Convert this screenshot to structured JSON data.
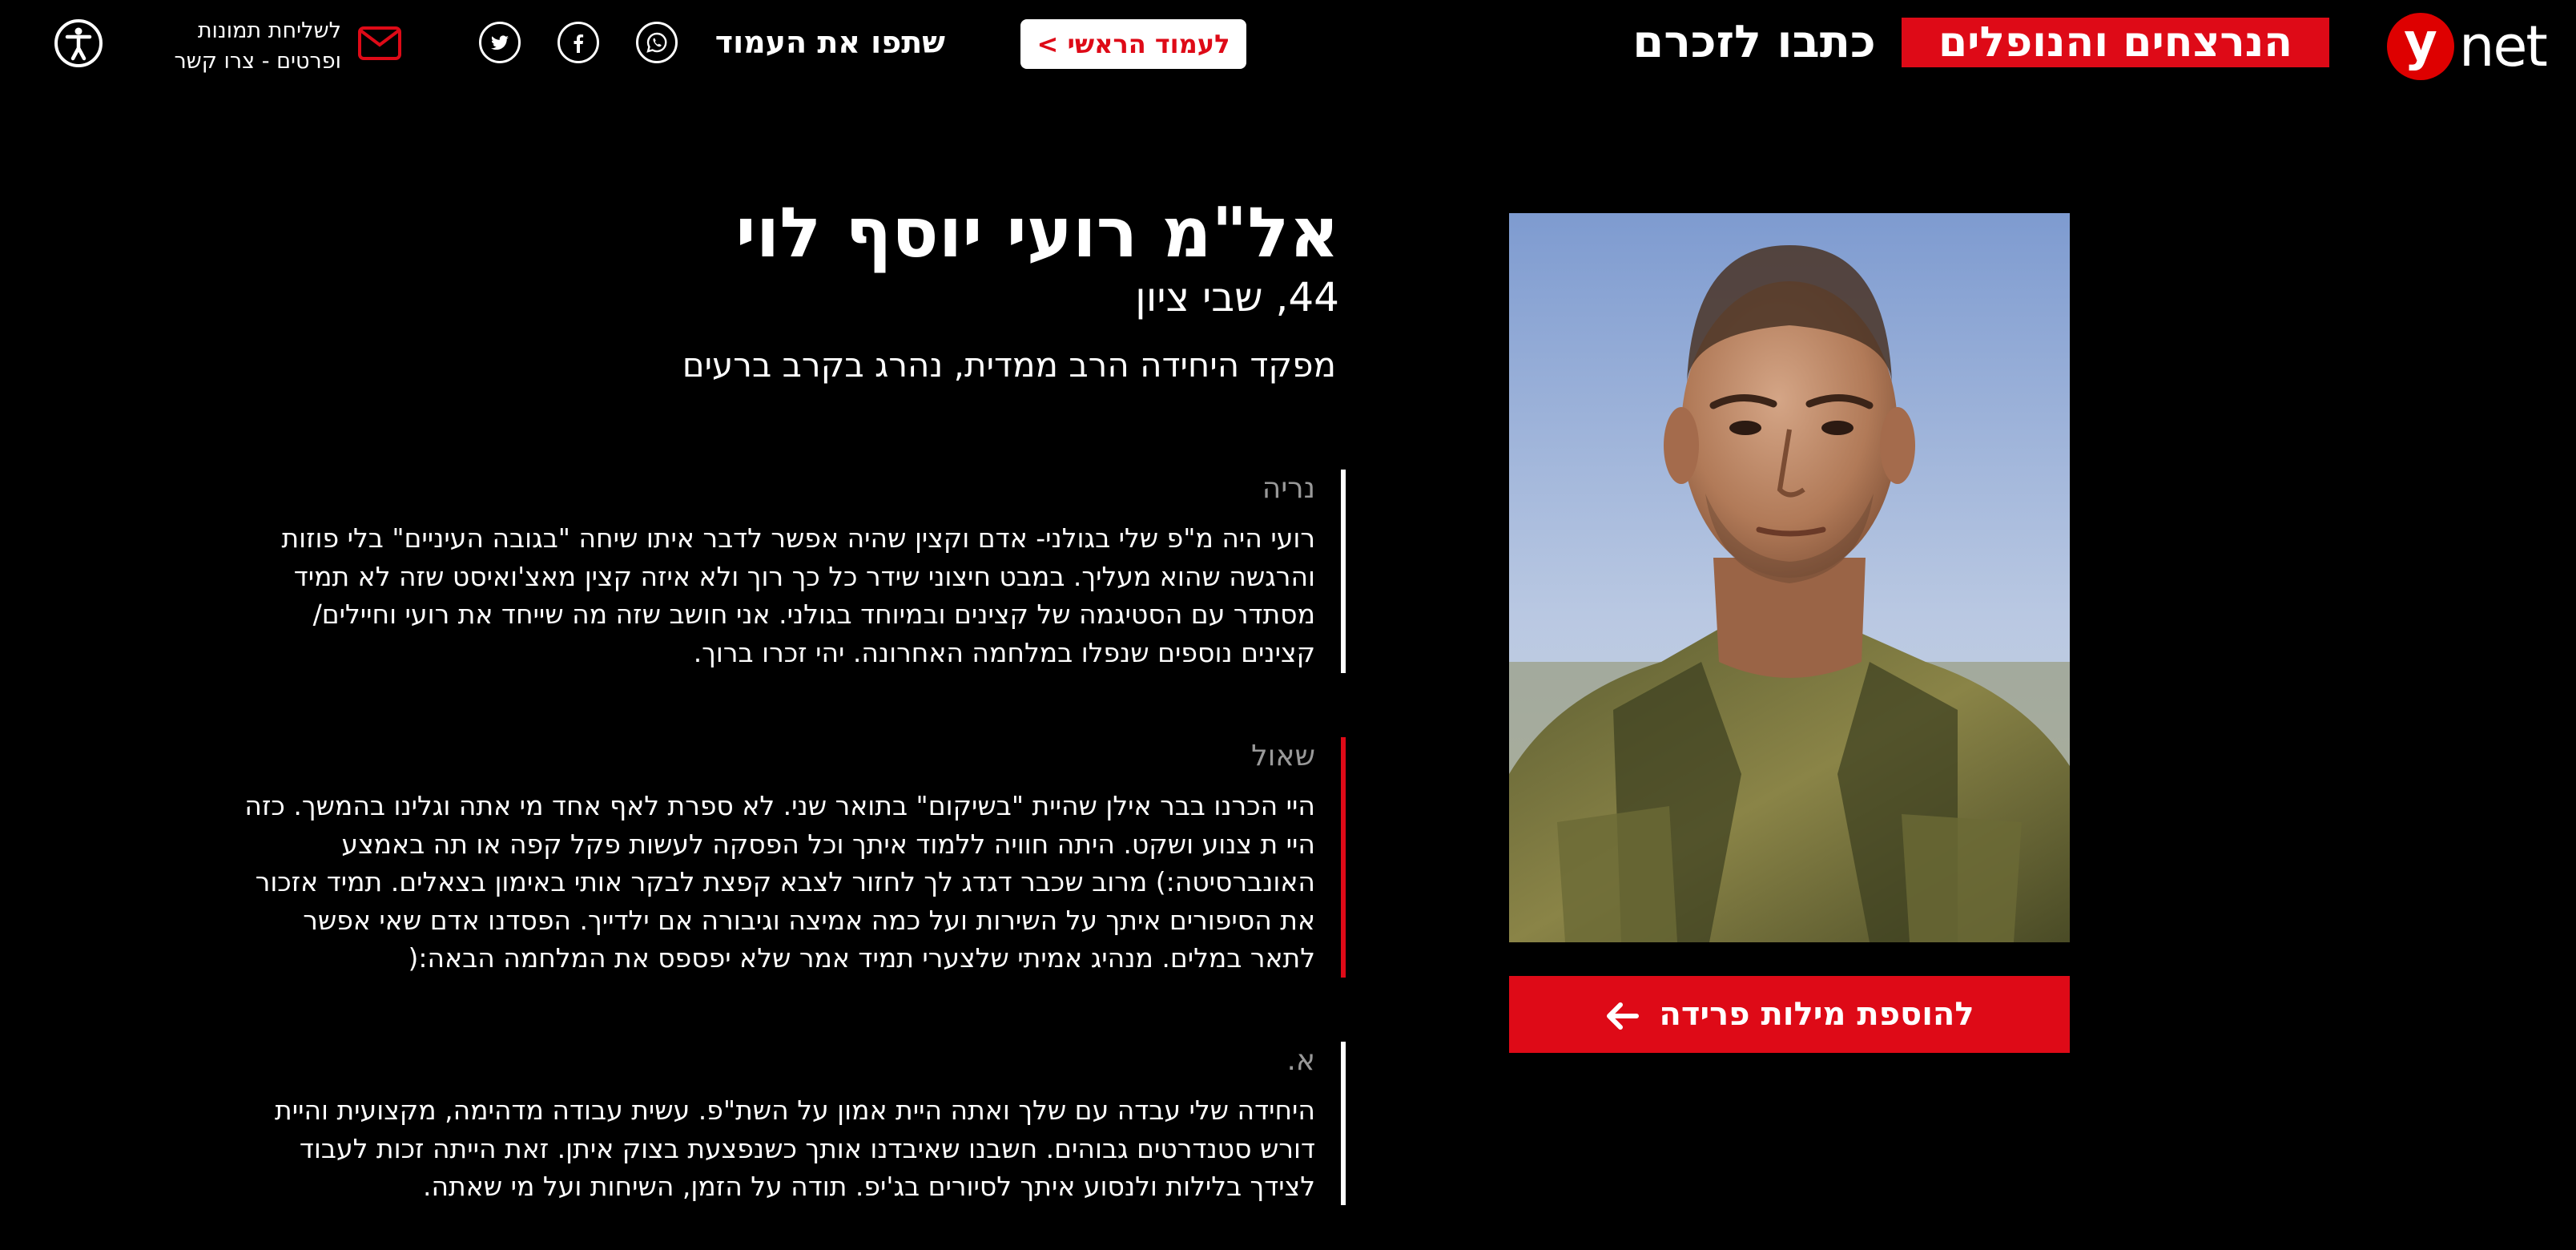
{
  "header": {
    "logo_letter": "y",
    "logo_suffix": "net",
    "brand_red": "הנרצחים והנופלים",
    "brand_white": "כתבו לזכרם",
    "home_button": "לעמוד הראשי >",
    "share_label": "שתפו את העמוד",
    "social_icons": [
      "whatsapp-icon",
      "facebook-icon",
      "twitter-icon"
    ],
    "contact_line1": "לשליחת תמונות",
    "contact_line2": "ופרטים - צרו קשר",
    "colors": {
      "accent": "#de0a17",
      "background": "#000000"
    }
  },
  "profile": {
    "name": "אל\"מ רועי יוסף לוי",
    "age_place": "44, שבי ציון",
    "role": "מפקד היחידה הרב ממדית, נהרג בקרב ברעים",
    "add_button": "להוספת מילות פרידה"
  },
  "comments": [
    {
      "author": "נריה",
      "bar_color": "#ffffff",
      "lines": [
        "רועי היה מ\"פ שלי בגולני- אדם וקצין שהיה אפשר לדבר איתו שיחה \"בגובה העיניים\" בלי פוזות",
        "והרגשה שהוא מעליך. במבט חיצוני שידר כל כך רוך ולא איזה קצין מאצ'ואיסט שזה לא תמיד",
        "מסתדר עם הסטיגמה של קצינים ובמיוחד בגולני. אני חושב שזה מה שייחד את רועי וחיילים/",
        "קצינים נוספים שנפלו במלחמה האחרונה. יהי זכרו ברוך."
      ]
    },
    {
      "author": "שאול",
      "bar_color": "#de0a17",
      "lines": [
        "היי הכרנו בבר אילן שהיית \"בשיקום\" בתואר שני. לא ספרת לאף אחד מי אתה וגלינו בהמשך. כזה",
        "היי ת צנוע ושקט. היתה חוויה ללמוד איתך וכל הפסקה לעשות פקל קפה או תה באמצע",
        "האונברסיטה:) מרוב שכבר דגדג לך לחזור לצבא קפצת לבקר אותי באימון בצאלים. תמיד אזכור",
        "את הסיפורים איתך על השירות ועל כמה אמיצה וגיבורה אם ילדייך. הפסדנו אדם שאי אפשר",
        "לתאר במלים. מנהיג אמיתי שלצערי תמיד אמר שלא יפספס את המלחמה הבאה:("
      ]
    },
    {
      "author": "א.",
      "bar_color": "#ffffff",
      "lines": [
        "היחידה שלי עבדה עם שלך ואתה היית אמון על השת\"פ. עשית עבודה מדהימה, מקצועית והיית",
        "דורש סטנדרטים גבוהים. חשבנו שאיבדנו אותך כשנפצעת בצוק איתן. זאת הייתה זכות לעבוד",
        "לצידך בלילות ולנסוע איתך לסיורים בג'יפ. תודה על הזמן, השיחות ועל מי שאתה."
      ]
    }
  ]
}
